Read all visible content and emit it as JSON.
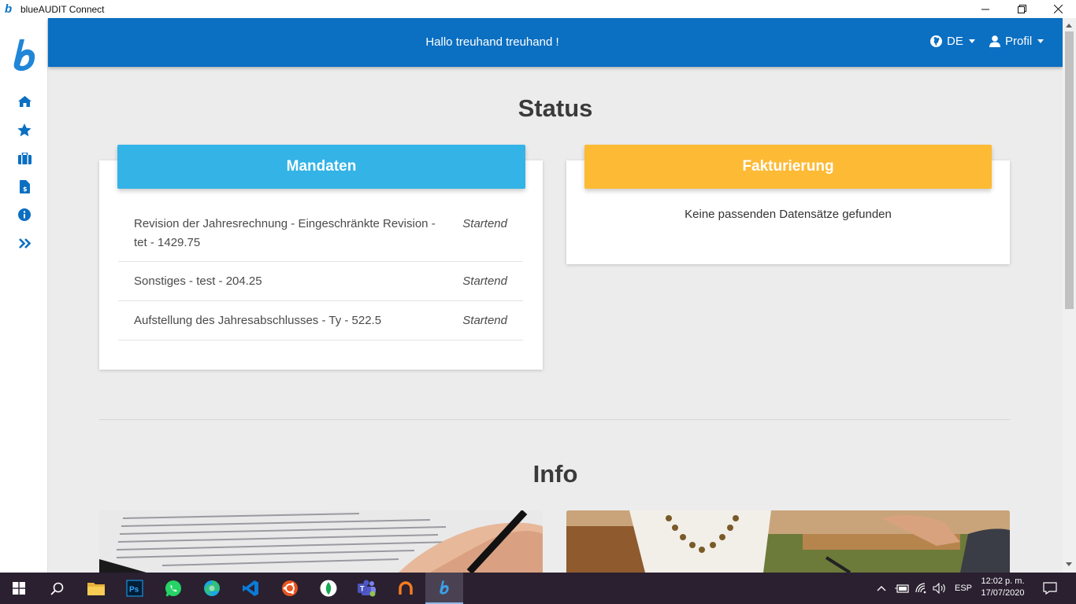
{
  "window": {
    "title": "blueAUDIT Connect",
    "app_icon_letter": "b"
  },
  "sidebar": {
    "items": [
      {
        "name": "home",
        "icon": "home-icon"
      },
      {
        "name": "favorites",
        "icon": "star-icon"
      },
      {
        "name": "mandates",
        "icon": "briefcase-icon"
      },
      {
        "name": "invoices",
        "icon": "invoice-dollar-icon"
      },
      {
        "name": "info",
        "icon": "info-circle-icon"
      },
      {
        "name": "expand",
        "icon": "double-chevron-right-icon"
      }
    ]
  },
  "header": {
    "greeting": "Hallo treuhand treuhand !",
    "language": "DE",
    "profile": "Profil"
  },
  "status": {
    "title": "Status",
    "mandaten": {
      "title": "Mandaten",
      "rows": [
        {
          "text": "Revision der Jahresrechnung - Eingeschränkte Revision - tet - 1429.75",
          "status": "Startend"
        },
        {
          "text": "Sonstiges - test - 204.25",
          "status": "Startend"
        },
        {
          "text": "Aufstellung des Jahresabschlusses - Ty - 522.5",
          "status": "Startend"
        }
      ]
    },
    "fakturierung": {
      "title": "Fakturierung",
      "empty": "Keine passenden Datensätze gefunden"
    }
  },
  "info": {
    "title": "Info"
  },
  "taskbar": {
    "language": "ESP",
    "time": "12:02 p. m.",
    "date": "17/07/2020",
    "photoshop_label": "Ps"
  },
  "colors": {
    "brand": "#0b6fc2",
    "mandaten": "#33b3e6",
    "fakturierung": "#fdba34"
  }
}
